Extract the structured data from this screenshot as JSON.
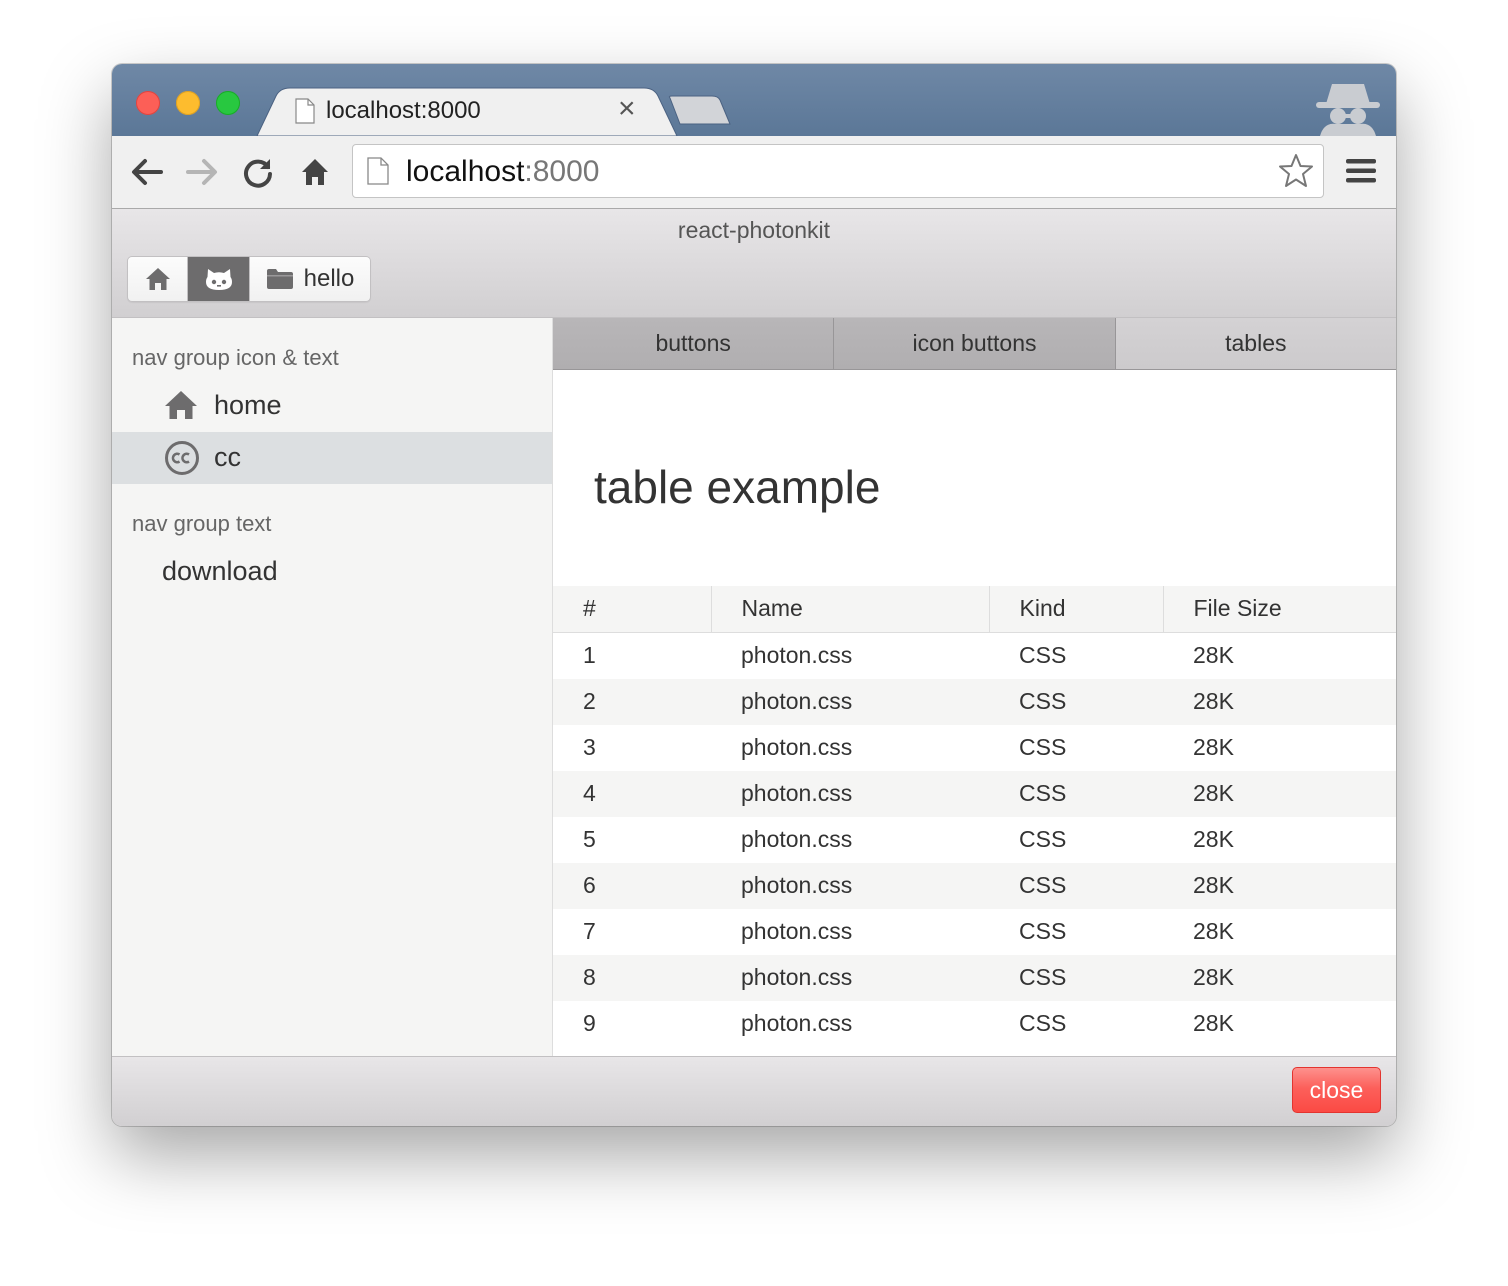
{
  "browser": {
    "tab_title": "localhost:8000",
    "tab_close": "×",
    "url_host": "localhost",
    "url_port": ":8000"
  },
  "app": {
    "title": "react-photonkit",
    "header_buttons": [
      {
        "icon": "home-icon"
      },
      {
        "icon": "github-icon",
        "active": true
      },
      {
        "icon": "folder-icon",
        "label": "hello"
      }
    ]
  },
  "sidebar": {
    "groups": [
      {
        "title": "nav group icon & text",
        "items": [
          {
            "icon": "home-icon",
            "label": "home"
          },
          {
            "icon": "creative-commons-icon",
            "label": "cc",
            "active": true
          }
        ]
      },
      {
        "title": "nav group text",
        "items": [
          {
            "label": "download"
          }
        ]
      }
    ]
  },
  "main": {
    "tabs": [
      {
        "label": "buttons"
      },
      {
        "label": "icon buttons"
      },
      {
        "label": "tables",
        "active": true
      }
    ],
    "title": "table example",
    "table": {
      "columns": [
        "#",
        "Name",
        "Kind",
        "File Size"
      ],
      "rows": [
        [
          "1",
          "photon.css",
          "CSS",
          "28K"
        ],
        [
          "2",
          "photon.css",
          "CSS",
          "28K"
        ],
        [
          "3",
          "photon.css",
          "CSS",
          "28K"
        ],
        [
          "4",
          "photon.css",
          "CSS",
          "28K"
        ],
        [
          "5",
          "photon.css",
          "CSS",
          "28K"
        ],
        [
          "6",
          "photon.css",
          "CSS",
          "28K"
        ],
        [
          "7",
          "photon.css",
          "CSS",
          "28K"
        ],
        [
          "8",
          "photon.css",
          "CSS",
          "28K"
        ],
        [
          "9",
          "photon.css",
          "CSS",
          "28K"
        ]
      ]
    }
  },
  "footer": {
    "close_label": "close"
  },
  "colors": {
    "titlebar": "#5b7797",
    "close_button": "#fc605b",
    "active_nav": "#dcdfe1"
  }
}
